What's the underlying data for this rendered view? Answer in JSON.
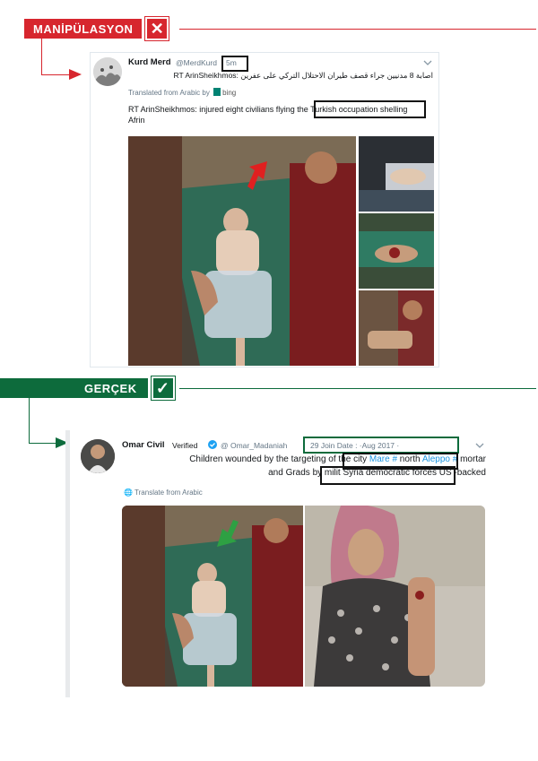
{
  "manipulation": {
    "label": "MANİPÜLASYON",
    "mark": "✕",
    "color": "#d7262e",
    "tweet": {
      "name": "Kurd Merd",
      "handle": "@MerdKurd",
      "time": "5m",
      "arabic_text": "RT ArinSheikhmos: اصابة 8 مدنيين جراء قصف طيران الاحتلال التركي على عفرين",
      "translated_from": "Translated from Arabic by",
      "bing": "bing",
      "text_prefix": "RT ArinSheikhmos: injured eight civilians flying the",
      "text_highlight": "Turkish occupation shelling",
      "text_suffix": "Afrin"
    }
  },
  "fact": {
    "label": "GERÇEK",
    "mark": "✓",
    "color": "#0d6b3c",
    "tweet": {
      "name": "Omar Civil",
      "verified": "Verified",
      "handle": "@ Omar_Madaniah",
      "date": "29 Join Date : ·Aug 2017 ·",
      "line1_prefix": "Children wounded by the targeting of the city",
      "line1_link1": "Mare #",
      "line1_mid": "north",
      "line1_link2": "Aleppo #",
      "line1_suffix": "mortar",
      "line2_prefix": "and Grads by milit",
      "line2_highlight": "Syria democratic forces US",
      "line2_suffix": "-backed",
      "translate": "Translate from Arabic"
    }
  },
  "icons": {
    "caret": "chevron-down-icon",
    "globe": "globe-icon",
    "verified": "verified-badge-icon"
  }
}
